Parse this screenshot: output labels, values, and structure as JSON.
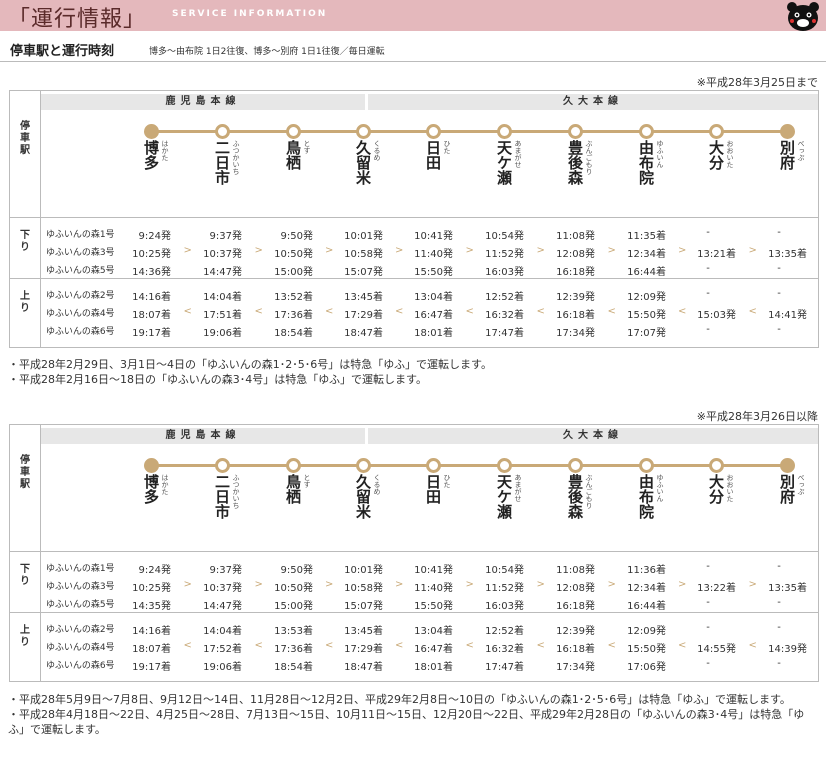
{
  "banner": {
    "title": "「運行情報」",
    "subtitle": "SERVICE INFORMATION",
    "mascot_icon": "bear-mascot-icon"
  },
  "section": {
    "title": "停車駅と運行時刻",
    "note": "博多〜由布院 1日2往復、博多〜別府 1日1往復／毎日運転"
  },
  "colors": {
    "banner": "#e4b8bc",
    "track": "#c9a977"
  },
  "labels": {
    "stops": "停車駅",
    "down": "下り",
    "up": "上り"
  },
  "lines": {
    "kagoshima": "鹿児島本線",
    "kyudai": "久大本線"
  },
  "stations": [
    {
      "name": "博多",
      "kana": "はかた"
    },
    {
      "name": "二日市",
      "kana": "ふつかいち"
    },
    {
      "name": "鳥栖",
      "kana": "とす"
    },
    {
      "name": "久留米",
      "kana": "くるめ"
    },
    {
      "name": "日田",
      "kana": "ひた"
    },
    {
      "name": "天ケ瀬",
      "kana": "あまがせ"
    },
    {
      "name": "豊後森",
      "kana": "ぶんごもり"
    },
    {
      "name": "由布院",
      "kana": "ゆふいん"
    },
    {
      "name": "大分",
      "kana": "おおいた"
    },
    {
      "name": "別府",
      "kana": "べっぷ"
    }
  ],
  "tables": [
    {
      "date_note": "※平成28年3月25日まで",
      "down": [
        {
          "train": "ゆふいんの森1号",
          "times": [
            "9:24発",
            "9:37発",
            "9:50発",
            "10:01発",
            "10:41発",
            "10:54発",
            "11:08発",
            "11:35着",
            "-",
            "-"
          ],
          "arrows": []
        },
        {
          "train": "ゆふいんの森3号",
          "times": [
            "10:25発",
            "10:37発",
            "10:50発",
            "10:58発",
            "11:40発",
            "11:52発",
            "12:08発",
            "12:34着",
            "13:21着",
            "13:35着"
          ],
          "arrows": [
            ">",
            ">",
            ">",
            ">",
            ">",
            ">",
            ">",
            ">",
            ">"
          ]
        },
        {
          "train": "ゆふいんの森5号",
          "times": [
            "14:36発",
            "14:47発",
            "15:00発",
            "15:07発",
            "15:50発",
            "16:03発",
            "16:18発",
            "16:44着",
            "-",
            "-"
          ],
          "arrows": []
        }
      ],
      "up": [
        {
          "train": "ゆふいんの森2号",
          "times": [
            "14:16着",
            "14:04着",
            "13:52着",
            "13:45着",
            "13:04着",
            "12:52着",
            "12:39発",
            "12:09発",
            "-",
            "-"
          ],
          "arrows": []
        },
        {
          "train": "ゆふいんの森4号",
          "times": [
            "18:07着",
            "17:51着",
            "17:36着",
            "17:29着",
            "16:47着",
            "16:32着",
            "16:18着",
            "15:50発",
            "15:03発",
            "14:41発"
          ],
          "arrows": [
            "<",
            "<",
            "<",
            "<",
            "<",
            "<",
            "<",
            "<",
            "<"
          ]
        },
        {
          "train": "ゆふいんの森6号",
          "times": [
            "19:17着",
            "19:06着",
            "18:54着",
            "18:47着",
            "18:01着",
            "17:47着",
            "17:34発",
            "17:07発",
            "-",
            "-"
          ],
          "arrows": []
        }
      ],
      "notes": [
        "・平成28年2月29日、3月1日〜4日の「ゆふいんの森1･2･5･6号」は特急「ゆふ」で運転します。",
        "・平成28年2月16日〜18日の「ゆふいんの森3･4号」は特急「ゆふ」で運転します。"
      ]
    },
    {
      "date_note": "※平成28年3月26日以降",
      "down": [
        {
          "train": "ゆふいんの森1号",
          "times": [
            "9:24発",
            "9:37発",
            "9:50発",
            "10:01発",
            "10:41発",
            "10:54発",
            "11:08発",
            "11:36着",
            "-",
            "-"
          ],
          "arrows": []
        },
        {
          "train": "ゆふいんの森3号",
          "times": [
            "10:25発",
            "10:37発",
            "10:50発",
            "10:58発",
            "11:40発",
            "11:52発",
            "12:08発",
            "12:34着",
            "13:22着",
            "13:35着"
          ],
          "arrows": [
            ">",
            ">",
            ">",
            ">",
            ">",
            ">",
            ">",
            ">",
            ">"
          ]
        },
        {
          "train": "ゆふいんの森5号",
          "times": [
            "14:35発",
            "14:47発",
            "15:00発",
            "15:07発",
            "15:50発",
            "16:03発",
            "16:18発",
            "16:44着",
            "-",
            "-"
          ],
          "arrows": []
        }
      ],
      "up": [
        {
          "train": "ゆふいんの森2号",
          "times": [
            "14:16着",
            "14:04着",
            "13:53着",
            "13:45着",
            "13:04着",
            "12:52着",
            "12:39発",
            "12:09発",
            "-",
            "-"
          ],
          "arrows": []
        },
        {
          "train": "ゆふいんの森4号",
          "times": [
            "18:07着",
            "17:52着",
            "17:36着",
            "17:29着",
            "16:47着",
            "16:32着",
            "16:18着",
            "15:50発",
            "14:55発",
            "14:39発"
          ],
          "arrows": [
            "<",
            "<",
            "<",
            "<",
            "<",
            "<",
            "<",
            "<",
            "<"
          ]
        },
        {
          "train": "ゆふいんの森6号",
          "times": [
            "19:17着",
            "19:06着",
            "18:54着",
            "18:47着",
            "18:01着",
            "17:47着",
            "17:34発",
            "17:06発",
            "-",
            "-"
          ],
          "arrows": []
        }
      ],
      "notes": [
        "・平成28年5月9日〜7月8日、9月12日〜14日、11月28日〜12月2日、平成29年2月8日〜10日の「ゆふいんの森1･2･5･6号」は特急「ゆふ」で運転します。",
        "・平成28年4月18日〜22日、4月25日〜28日、7月13日〜15日、10月11日〜15日、12月20日〜22日、平成29年2月28日の「ゆふいんの森3･4号」は特急「ゆふ」で運転します。"
      ]
    }
  ]
}
